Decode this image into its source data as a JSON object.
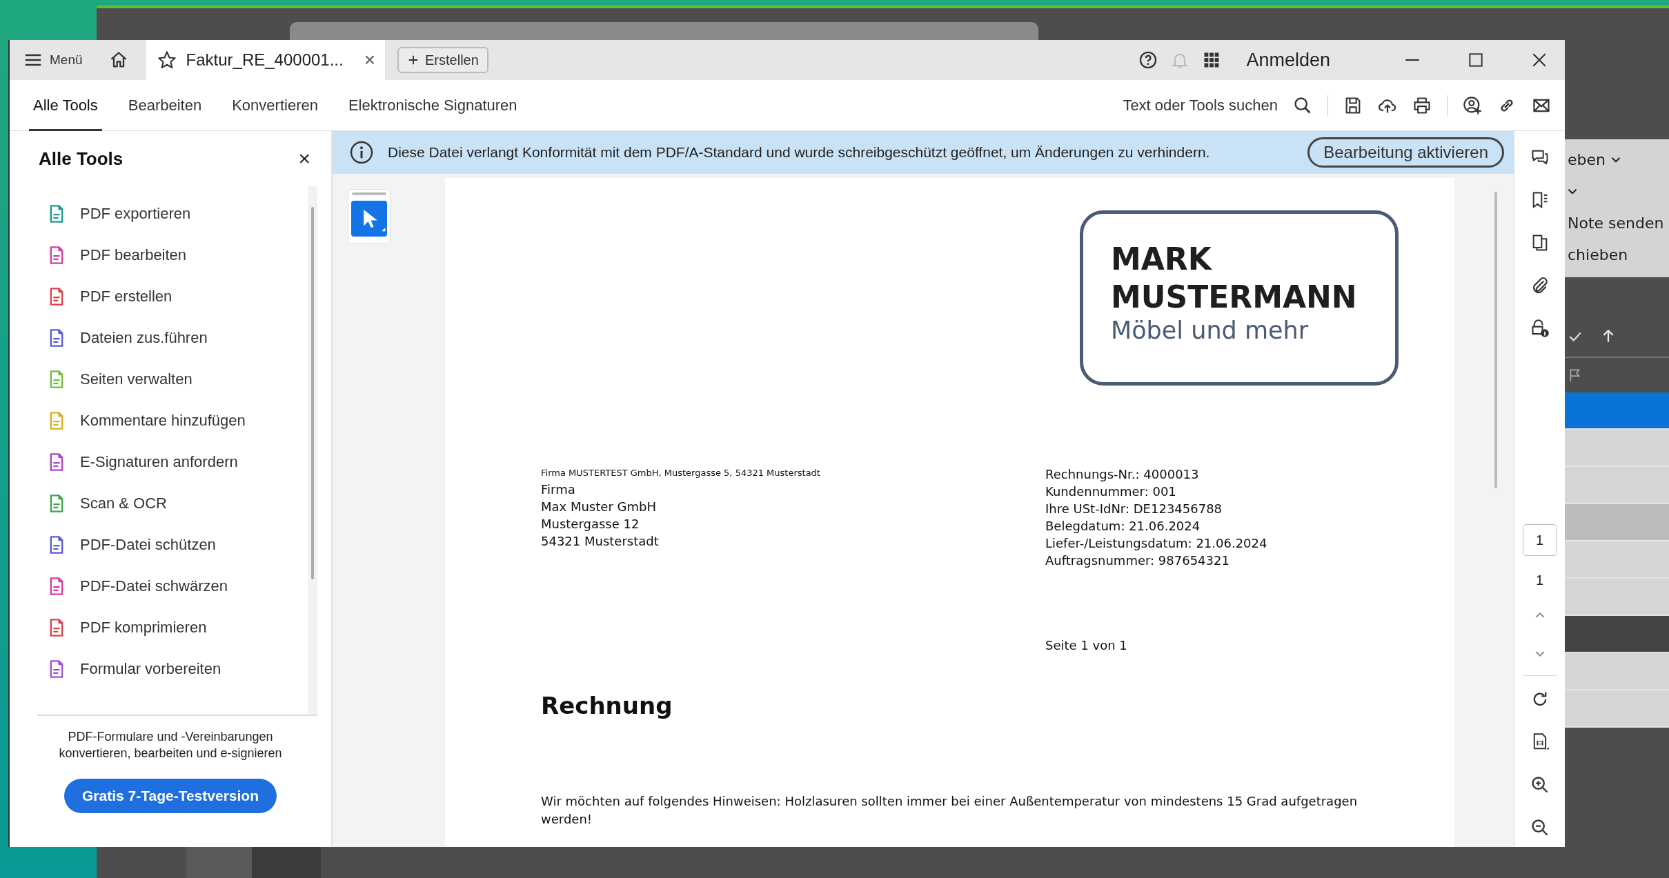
{
  "titlebar": {
    "menu": "Menü",
    "tab": {
      "title": "Faktur_RE_400001...",
      "close": "×"
    },
    "create_button": "Erstellen",
    "sign_in": "Anmelden"
  },
  "toolbar": {
    "tabs": [
      {
        "label": "Alle Tools",
        "selected": true
      },
      {
        "label": "Bearbeiten",
        "selected": false
      },
      {
        "label": "Konvertieren",
        "selected": false
      },
      {
        "label": "Elektronische Signaturen",
        "selected": false
      }
    ],
    "search": "Text oder Tools suchen"
  },
  "sidebar": {
    "title": "Alle Tools",
    "close": "×",
    "items": [
      {
        "label": "PDF exportieren",
        "color": "#1a9a8e"
      },
      {
        "label": "PDF bearbeiten",
        "color": "#d63ca0"
      },
      {
        "label": "PDF erstellen",
        "color": "#e0404a"
      },
      {
        "label": "Dateien zus.führen",
        "color": "#5a5ae0"
      },
      {
        "label": "Seiten verwalten",
        "color": "#6cbf3a"
      },
      {
        "label": "Kommentare hinzufügen",
        "color": "#d8b21a"
      },
      {
        "label": "E-Signaturen anfordern",
        "color": "#b040c8"
      },
      {
        "label": "Scan & OCR",
        "color": "#3aa84a"
      },
      {
        "label": "PDF-Datei schützen",
        "color": "#5a5ae0"
      },
      {
        "label": "PDF-Datei schwärzen",
        "color": "#d63ca0"
      },
      {
        "label": "PDF komprimieren",
        "color": "#e0404a"
      },
      {
        "label": "Formular vorbereiten",
        "color": "#a050d8"
      }
    ],
    "promo": "PDF-Formulare und -Vereinbarungen konvertieren, bearbeiten und e-signieren",
    "trial_button": "Gratis 7-Tage-Testversion"
  },
  "banner": {
    "message": "Diese Datei verlangt Konformität mit dem PDF/A-Standard und wurde schreibgeschützt geöffnet, um Änderungen zu verhindern.",
    "button": "Bearbeitung aktivieren"
  },
  "document": {
    "logo": {
      "line1": "MARK",
      "line2": "MUSTERMANN",
      "tagline": "Möbel und mehr"
    },
    "sender_line": "Firma MUSTERTEST GmbH, Mustergasse 5, 54321 Musterstadt",
    "recipient": [
      "Firma",
      "Max Muster GmbH",
      "Mustergasse 12",
      "54321 Musterstadt"
    ],
    "meta": [
      "Rechnungs-Nr.: 4000013",
      "Kundennummer: 001",
      "Ihre USt-IdNr: DE123456788",
      "Belegdatum: 21.06.2024",
      "Liefer-/Leistungsdatum: 21.06.2024",
      "Auftragsnummer: 987654321"
    ],
    "page_label": "Seite 1 von 1",
    "heading": "Rechnung",
    "note": "Wir möchten auf folgendes Hinweisen: Holzlasuren sollten immer bei einer Außentemperatur von mindestens 15 Grad aufgetragen werden!"
  },
  "page_nav": {
    "current": "1",
    "total": "1"
  },
  "background_window": {
    "texts": [
      "eben",
      "Note senden",
      "chieben"
    ],
    "rows": [
      {
        "kind": "selected"
      },
      {
        "kind": "plain"
      },
      {
        "kind": "plain"
      },
      {
        "kind": "mid"
      },
      {
        "kind": "plain"
      },
      {
        "kind": "plain"
      },
      {
        "kind": "dark"
      },
      {
        "kind": "plain"
      },
      {
        "kind": "plain"
      }
    ]
  }
}
